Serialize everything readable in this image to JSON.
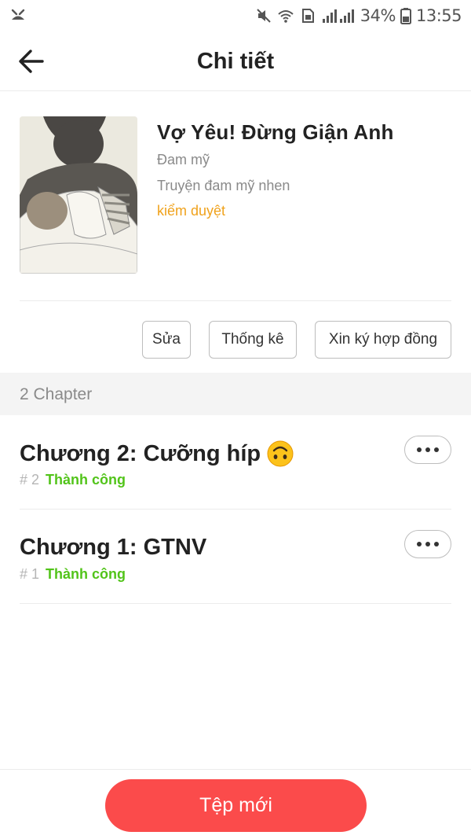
{
  "status_bar": {
    "battery": "34%",
    "time": "13:55",
    "icons": [
      "notification-icon",
      "mute-icon",
      "wifi-icon",
      "sim-icon",
      "signal-icon",
      "battery-icon"
    ]
  },
  "header": {
    "title": "Chi tiết",
    "back_icon": "arrow-left-icon"
  },
  "story": {
    "title": "Vợ Yêu! Đừng Giận Anh",
    "genre": "Đam mỹ",
    "description": "Truyện đam mỹ nhen",
    "status": "kiểm duyệt",
    "cover_icon": "cover-illustration"
  },
  "actions": {
    "edit_label": "Sửa",
    "stats_label": "Thống kê",
    "contract_label": "Xin ký hợp đồng"
  },
  "chapters": {
    "count_label": "2 Chapter",
    "items": [
      {
        "title": "Chương 2: Cưỡng híp",
        "emoji": "upside-down-face-icon",
        "number": "# 2",
        "state": "Thành công"
      },
      {
        "title": "Chương 1: GTNV",
        "number": "# 1",
        "state": "Thành công"
      }
    ]
  },
  "footer": {
    "new_button_label": "Tệp mới"
  },
  "colors": {
    "accent_red": "#fb4b4b",
    "status_orange": "#f0a21c",
    "success_green": "#52c41a"
  }
}
